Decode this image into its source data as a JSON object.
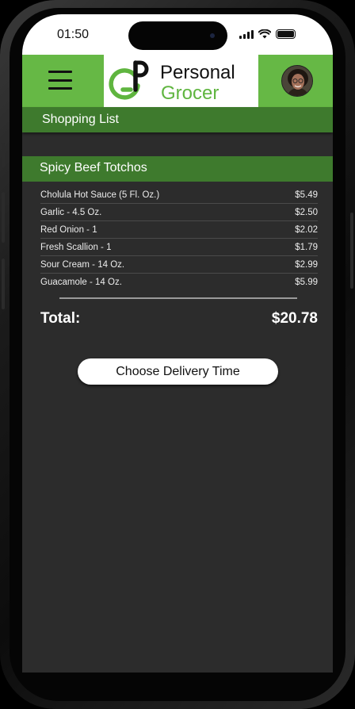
{
  "status_bar": {
    "time": "01:50"
  },
  "app": {
    "logo": {
      "line1": "Personal",
      "line2": "Grocer"
    },
    "page_title": "Shopping List"
  },
  "recipe": {
    "name": "Spicy Beef Totchos",
    "items": [
      {
        "name": "Cholula Hot Sauce (5 Fl. Oz.)",
        "price": "$5.49"
      },
      {
        "name": "Garlic - 4.5 Oz.",
        "price": "$2.50"
      },
      {
        "name": "Red Onion - 1",
        "price": "$2.02"
      },
      {
        "name": "Fresh Scallion - 1",
        "price": "$1.79"
      },
      {
        "name": "Sour Cream - 14 Oz.",
        "price": "$2.99"
      },
      {
        "name": "Guacamole - 14 Oz.",
        "price": "$5.99"
      }
    ]
  },
  "total": {
    "label": "Total:",
    "value": "$20.78"
  },
  "cta": {
    "label": "Choose Delivery Time"
  },
  "icons": [
    "menu-icon",
    "signal-icon",
    "wifi-icon",
    "battery-icon",
    "logo-icon",
    "avatar"
  ],
  "colors": {
    "brand_green": "#66b845",
    "dark_green": "#3e7a2d",
    "background": "#2c2c2c",
    "logo_green": "#5fb53f"
  }
}
